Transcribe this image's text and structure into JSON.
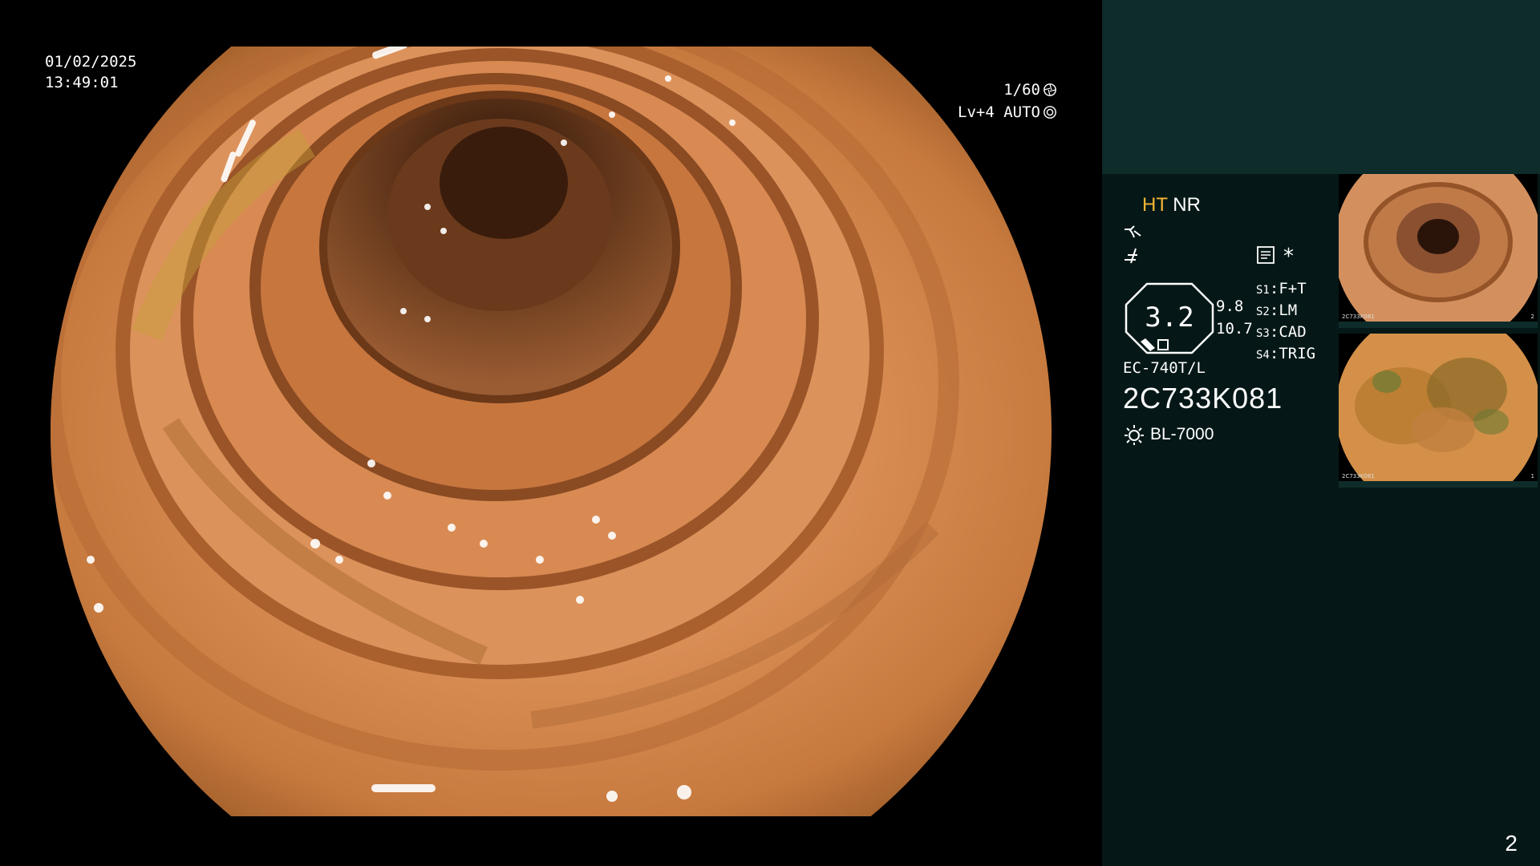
{
  "timestamp": {
    "date": "01/02/2025",
    "time": "13:49:01"
  },
  "shutter": {
    "speed": "1/60",
    "mode": "Lv+4 AUTO",
    "speed_icon": "shutter-icon",
    "mode_icon": "iris-icon"
  },
  "image_mode": {
    "primary": "HT",
    "secondary": "NR",
    "primary_color": "#f3b433"
  },
  "icons": {
    "enhance": "enhance-curve-icon",
    "filter": "filter-icon",
    "memo": "memo-icon",
    "light": "light-source-icon"
  },
  "gauge": {
    "value": "3.2",
    "sub_top": "9.8",
    "sub_bottom": "10.7"
  },
  "settings": [
    {
      "key": "S1",
      "value": "F+T"
    },
    {
      "key": "S2",
      "value": "LM"
    },
    {
      "key": "S3",
      "value": "CAD"
    },
    {
      "key": "S4",
      "value": "TRIG"
    }
  ],
  "marker": "*",
  "scope": {
    "model": "EC-740T/L",
    "serial": "2C733K081"
  },
  "light_source": "BL-7000",
  "thumbnails": [
    {
      "index": "2",
      "label": "2C733K081"
    },
    {
      "index": "1",
      "label": "2C733K081"
    }
  ],
  "page_number": "2",
  "colors": {
    "panel_top": "#0e2c2a",
    "panel_main": "#051817",
    "accent": "#f3b433"
  }
}
